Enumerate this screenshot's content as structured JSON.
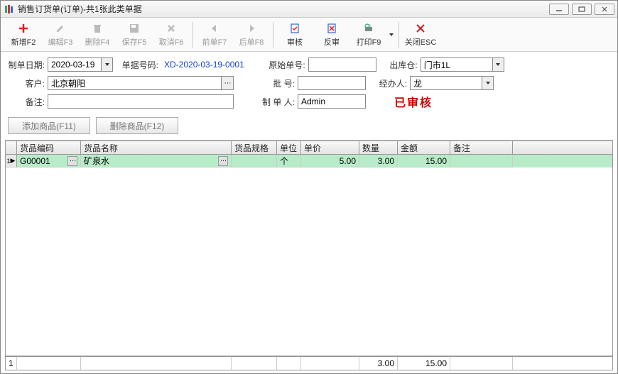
{
  "window": {
    "title": "销售订货单(订单)-共1张此类单据"
  },
  "toolbar": {
    "new": "新增F2",
    "edit": "编辑F3",
    "delete": "删除F4",
    "save": "保存F5",
    "cancel": "取消F6",
    "prev": "前单F7",
    "next": "后单F8",
    "audit": "审核",
    "unaudit": "反审",
    "print": "打印F9",
    "close": "关闭ESC"
  },
  "form": {
    "date_label": "制单日期:",
    "date_value": "2020-03-19",
    "docnum_label": "单据号码:",
    "docnum_value": "XD-2020-03-19-0001",
    "origdoc_label": "原始单号:",
    "origdoc_value": "",
    "warehouse_label": "出库仓:",
    "warehouse_value": "门市1L",
    "customer_label": "客户:",
    "customer_value": "北京朝阳",
    "batch_label": "批    号:",
    "batch_value": "",
    "handler_label": "经办人:",
    "handler_value": "龙",
    "remark_label": "备注:",
    "remark_value": "",
    "maker_label": "制 单 人:",
    "maker_value": "Admin",
    "status": "已审核"
  },
  "buttons": {
    "add_item": "添加商品(F11)",
    "del_item": "删除商品(F12)"
  },
  "grid": {
    "headers": {
      "code": "货品编码",
      "name": "货品名称",
      "spec": "货品规格",
      "unit": "单位",
      "price": "单价",
      "qty": "数量",
      "amount": "金额",
      "remark": "备注"
    },
    "rows": [
      {
        "idx": "1",
        "code": "G00001",
        "name": "矿泉水",
        "spec": "",
        "unit": "个",
        "price": "5.00",
        "qty": "3.00",
        "amount": "15.00",
        "remark": ""
      }
    ],
    "footer": {
      "idx": "1",
      "qty": "3.00",
      "amount": "15.00"
    }
  }
}
